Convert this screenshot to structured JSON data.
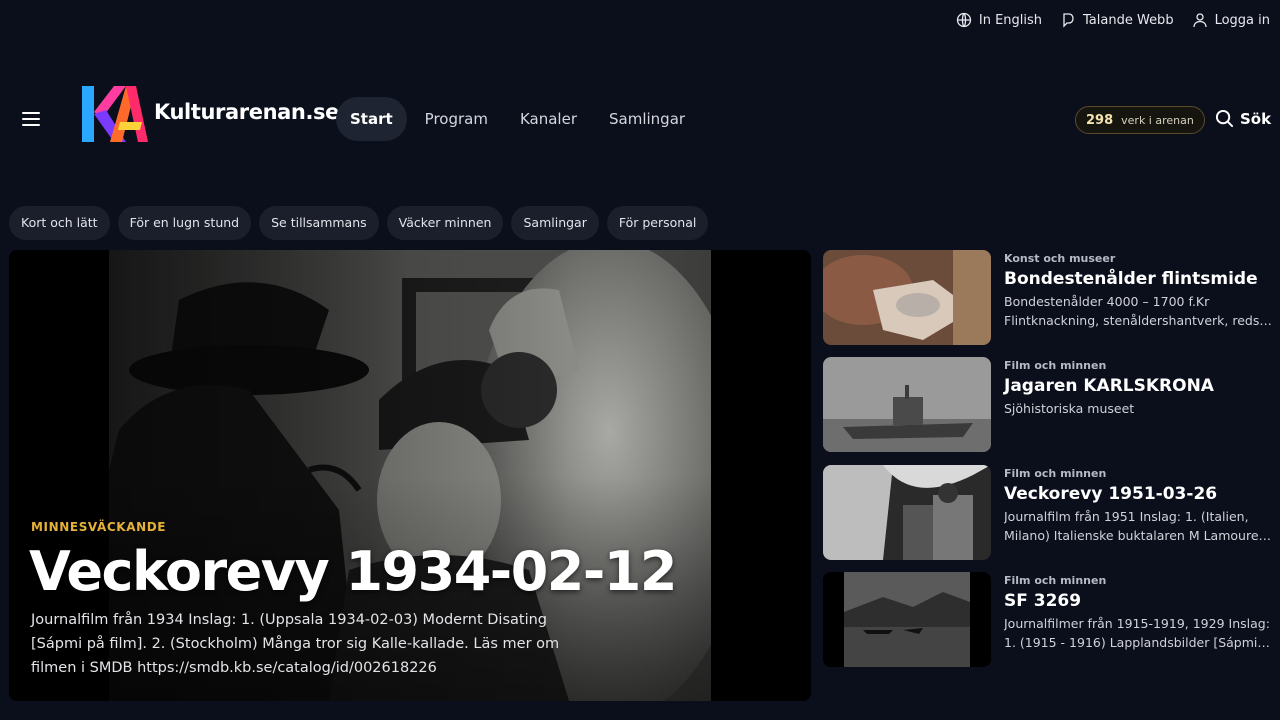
{
  "topbar": {
    "english": "In English",
    "talande": "Talande Webb",
    "login": "Logga in"
  },
  "header": {
    "logo_text": "Kulturarenan.se",
    "nav": [
      "Start",
      "Program",
      "Kanaler",
      "Samlingar"
    ],
    "count": "298",
    "count_label": "verk i arenan",
    "search": "Sök"
  },
  "chips": [
    "Kort och lätt",
    "För en lugn stund",
    "Se tillsammans",
    "Väcker minnen",
    "Samlingar",
    "För personal"
  ],
  "hero": {
    "tag": "MINNESVÄCKANDE",
    "title": "Veckorevy 1934-02-12",
    "desc": "Journalfilm från 1934 Inslag: 1. (Uppsala 1934-02-03) Modernt Disating [Sápmi på film]. 2. (Stockholm) Många tror sig Kalle-kallade. Läs mer om filmen i SMDB https://smdb.kb.se/catalog/id/002618226"
  },
  "cards": [
    {
      "category": "Konst och museer",
      "title": "Bondestenålder flintsmide",
      "line1": "Bondestenålder 4000 – 1700 f.Kr",
      "line2": "Flintknackning, stenåldershantverk, redska..."
    },
    {
      "category": "Film och minnen",
      "title": "Jagaren KARLSKRONA",
      "line1": "Sjöhistoriska museet",
      "line2": ""
    },
    {
      "category": "Film och minnen",
      "title": "Veckorevy 1951-03-26",
      "line1": "Journalfilm från 1951 Inslag: 1. (Italien,",
      "line2": "Milano) Italienske buktalaren M Lamouret ..."
    },
    {
      "category": "Film och minnen",
      "title": "SF 3269",
      "line1": "Journalfilmer från 1915-1919, 1929 Inslag:",
      "line2": "1. (1915 - 1916) Lapplandsbilder [Sápmi p..."
    }
  ],
  "icons": {
    "english": "globe-icon",
    "talande": "speech-icon",
    "login": "user-icon",
    "menu": "hamburger-icon",
    "search": "search-icon"
  },
  "colors": {
    "background": "#0b0f1c",
    "accent": "#e6b13a",
    "chip": "#1b1f2c"
  }
}
